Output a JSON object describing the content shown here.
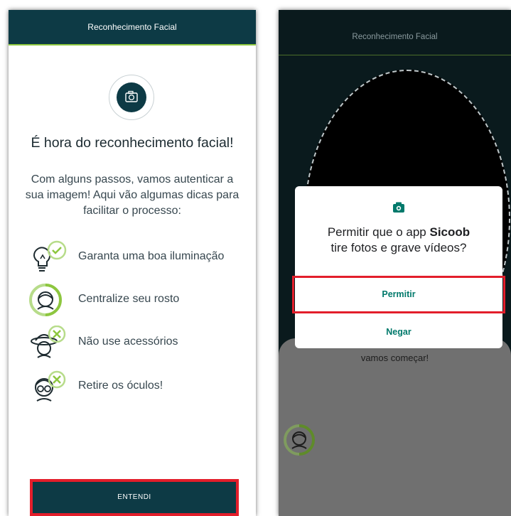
{
  "left_screen": {
    "title": "Reconhecimento Facial",
    "headline": "É hora do reconhecimento facial!",
    "intro": "Com alguns passos, vamos autenticar a sua imagem! Aqui vão algumas dicas para facilitar o processo:",
    "tips": [
      {
        "label": "Garanta uma boa iluminação",
        "icon": "lightbulb-check-icon"
      },
      {
        "label": "Centralize seu rosto",
        "icon": "face-centered-icon"
      },
      {
        "label": "Não use acessórios",
        "icon": "hat-no-icon"
      },
      {
        "label": "Retire os óculos!",
        "icon": "glasses-no-icon"
      }
    ],
    "button_label": "ENTENDI"
  },
  "right_screen": {
    "title": "Reconhecimento Facial",
    "background_text": "vamos começar!",
    "dialog": {
      "title_prefix": "Permitir que o app ",
      "app_name": "Sicoob",
      "title_suffix": " tire fotos e grave vídeos?",
      "allow_label": "Permitir",
      "deny_label": "Negar"
    }
  },
  "colors": {
    "brand_dark": "#0d3a45",
    "accent_green": "#8dc63f",
    "highlight_red": "#e31e2b",
    "dialog_button_teal": "#00796b"
  }
}
